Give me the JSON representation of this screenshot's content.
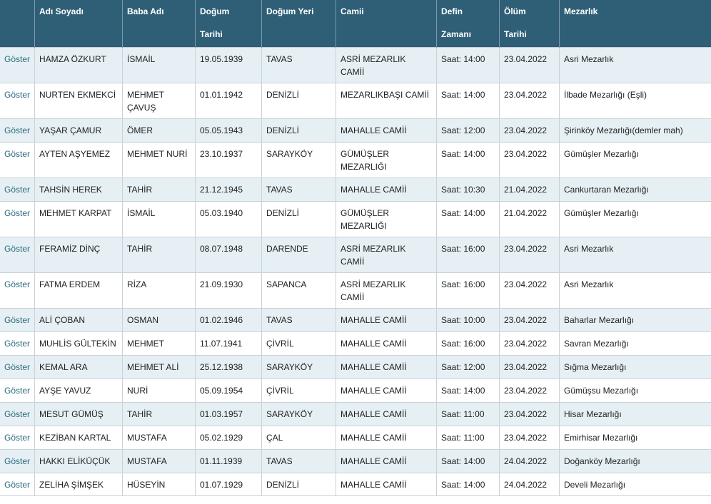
{
  "table": {
    "headers": [
      {
        "lines": [
          ""
        ]
      },
      {
        "lines": [
          "Adı Soyadı"
        ]
      },
      {
        "lines": [
          "Baba Adı"
        ]
      },
      {
        "lines": [
          "Doğum",
          "Tarihi"
        ]
      },
      {
        "lines": [
          "Doğum Yeri"
        ]
      },
      {
        "lines": [
          "Camii"
        ]
      },
      {
        "lines": [
          "Defin",
          "Zamanı"
        ]
      },
      {
        "lines": [
          "Ölüm",
          "Tarihi"
        ]
      },
      {
        "lines": [
          "Mezarlık"
        ]
      }
    ],
    "rows": [
      {
        "link": "Göster",
        "name": "HAMZA ÖZKURT",
        "father": "İSMAİL",
        "birth_date": "19.05.1939",
        "birth_place": "TAVAS",
        "mosque": "ASRİ MEZARLIK CAMİİ",
        "burial_time": "Saat: 14:00",
        "death_date": "23.04.2022",
        "cemetery": "Asri Mezarlık"
      },
      {
        "link": "Göster",
        "name": "NURTEN EKMEKCİ",
        "father": "MEHMET ÇAVUŞ",
        "birth_date": "01.01.1942",
        "birth_place": "DENİZLİ",
        "mosque": "MEZARLIKBAŞI CAMİİ",
        "burial_time": "Saat: 14:00",
        "death_date": "23.04.2022",
        "cemetery": "İlbade Mezarlığı (Eşli)"
      },
      {
        "link": "Göster",
        "name": "YAŞAR ÇAMUR",
        "father": "ÖMER",
        "birth_date": "05.05.1943",
        "birth_place": "DENİZLİ",
        "mosque": "MAHALLE CAMİİ",
        "burial_time": "Saat: 12:00",
        "death_date": "23.04.2022",
        "cemetery": "Şirinköy Mezarlığı(demler mah)"
      },
      {
        "link": "Göster",
        "name": "AYTEN AŞYEMEZ",
        "father": "MEHMET NURİ",
        "birth_date": "23.10.1937",
        "birth_place": "SARAYKÖY",
        "mosque": "GÜMÜŞLER MEZARLIĞI",
        "burial_time": "Saat: 14:00",
        "death_date": "23.04.2022",
        "cemetery": "Gümüşler Mezarlığı"
      },
      {
        "link": "Göster",
        "name": "TAHSİN HEREK",
        "father": "TAHİR",
        "birth_date": "21.12.1945",
        "birth_place": "TAVAS",
        "mosque": "MAHALLE CAMİİ",
        "burial_time": "Saat: 10:30",
        "death_date": "21.04.2022",
        "cemetery": "Cankurtaran Mezarlığı"
      },
      {
        "link": "Göster",
        "name": "MEHMET KARPAT",
        "father": "İSMAİL",
        "birth_date": "05.03.1940",
        "birth_place": "DENİZLİ",
        "mosque": "GÜMÜŞLER MEZARLIĞI",
        "burial_time": "Saat: 14:00",
        "death_date": "21.04.2022",
        "cemetery": "Gümüşler Mezarlığı"
      },
      {
        "link": "Göster",
        "name": "FERAMİZ DİNÇ",
        "father": "TAHİR",
        "birth_date": "08.07.1948",
        "birth_place": "DARENDE",
        "mosque": "ASRİ MEZARLIK CAMİİ",
        "burial_time": "Saat: 16:00",
        "death_date": "23.04.2022",
        "cemetery": "Asri Mezarlık"
      },
      {
        "link": "Göster",
        "name": "FATMA ERDEM",
        "father": "RİZA",
        "birth_date": "21.09.1930",
        "birth_place": "SAPANCA",
        "mosque": "ASRİ MEZARLIK CAMİİ",
        "burial_time": "Saat: 16:00",
        "death_date": "23.04.2022",
        "cemetery": "Asri Mezarlık"
      },
      {
        "link": "Göster",
        "name": "ALİ ÇOBAN",
        "father": "OSMAN",
        "birth_date": "01.02.1946",
        "birth_place": "TAVAS",
        "mosque": "MAHALLE CAMİİ",
        "burial_time": "Saat: 10:00",
        "death_date": "23.04.2022",
        "cemetery": "Baharlar Mezarlığı"
      },
      {
        "link": "Göster",
        "name": "MUHLİS GÜLTEKİN",
        "father": "MEHMET",
        "birth_date": "11.07.1941",
        "birth_place": "ÇİVRİL",
        "mosque": "MAHALLE CAMİİ",
        "burial_time": "Saat: 16:00",
        "death_date": "23.04.2022",
        "cemetery": "Savran Mezarlığı"
      },
      {
        "link": "Göster",
        "name": "KEMAL ARA",
        "father": "MEHMET ALİ",
        "birth_date": "25.12.1938",
        "birth_place": "SARAYKÖY",
        "mosque": "MAHALLE CAMİİ",
        "burial_time": "Saat: 12:00",
        "death_date": "23.04.2022",
        "cemetery": "Sığma Mezarlığı"
      },
      {
        "link": "Göster",
        "name": "AYŞE YAVUZ",
        "father": "NURİ",
        "birth_date": "05.09.1954",
        "birth_place": "ÇİVRİL",
        "mosque": "MAHALLE CAMİİ",
        "burial_time": "Saat: 14:00",
        "death_date": "23.04.2022",
        "cemetery": "Gümüşsu Mezarlığı"
      },
      {
        "link": "Göster",
        "name": "MESUT GÜMÜŞ",
        "father": "TAHİR",
        "birth_date": "01.03.1957",
        "birth_place": "SARAYKÖY",
        "mosque": "MAHALLE CAMİİ",
        "burial_time": "Saat: 11:00",
        "death_date": "23.04.2022",
        "cemetery": "Hisar Mezarlığı"
      },
      {
        "link": "Göster",
        "name": "KEZİBAN KARTAL",
        "father": "MUSTAFA",
        "birth_date": "05.02.1929",
        "birth_place": "ÇAL",
        "mosque": "MAHALLE CAMİİ",
        "burial_time": "Saat: 11:00",
        "death_date": "23.04.2022",
        "cemetery": "Emirhisar Mezarlığı"
      },
      {
        "link": "Göster",
        "name": "HAKKI ELİKÜÇÜK",
        "father": "MUSTAFA",
        "birth_date": "01.11.1939",
        "birth_place": "TAVAS",
        "mosque": "MAHALLE CAMİİ",
        "burial_time": "Saat: 14:00",
        "death_date": "24.04.2022",
        "cemetery": "Doğanköy Mezarlığı"
      },
      {
        "link": "Göster",
        "name": "ZELİHA ŞİMŞEK",
        "father": "HÜSEYİN",
        "birth_date": "01.07.1929",
        "birth_place": "DENİZLİ",
        "mosque": "MAHALLE CAMİİ",
        "burial_time": "Saat: 14:00",
        "death_date": "24.04.2022",
        "cemetery": "Develi Mezarlığı"
      }
    ]
  }
}
